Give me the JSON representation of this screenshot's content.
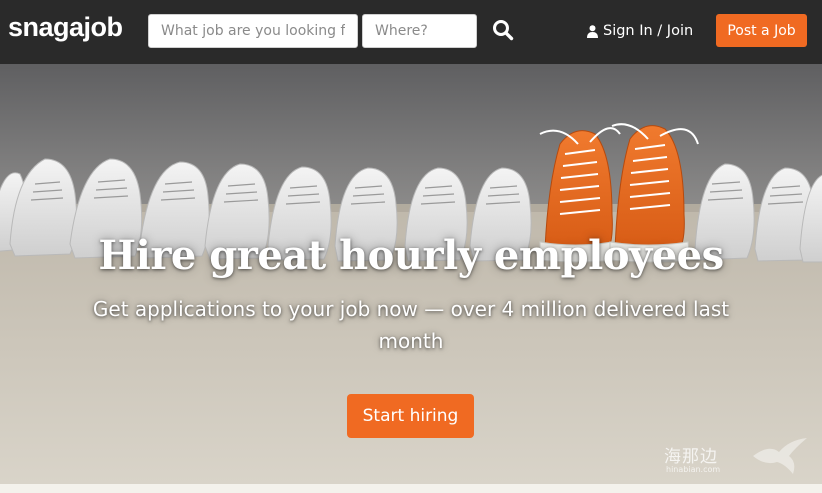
{
  "header": {
    "logo": "snagajob",
    "search": {
      "what_placeholder": "What job are you looking for?",
      "where_placeholder": "Where?"
    },
    "search_icon": "search-icon",
    "signin_label": "Sign In / Join",
    "signin_icon": "user-icon",
    "post_job_label": "Post a Job"
  },
  "hero": {
    "title": "Hire great hourly employees",
    "subtitle": "Get applications to your job now — over 4 million delivered last month",
    "cta_label": "Start hiring"
  },
  "watermark": {
    "text": "海那边",
    "url": "hinabian.com"
  },
  "colors": {
    "header_bg": "#2a2a2a",
    "accent": "#f06a22",
    "text_light": "#ffffff"
  }
}
